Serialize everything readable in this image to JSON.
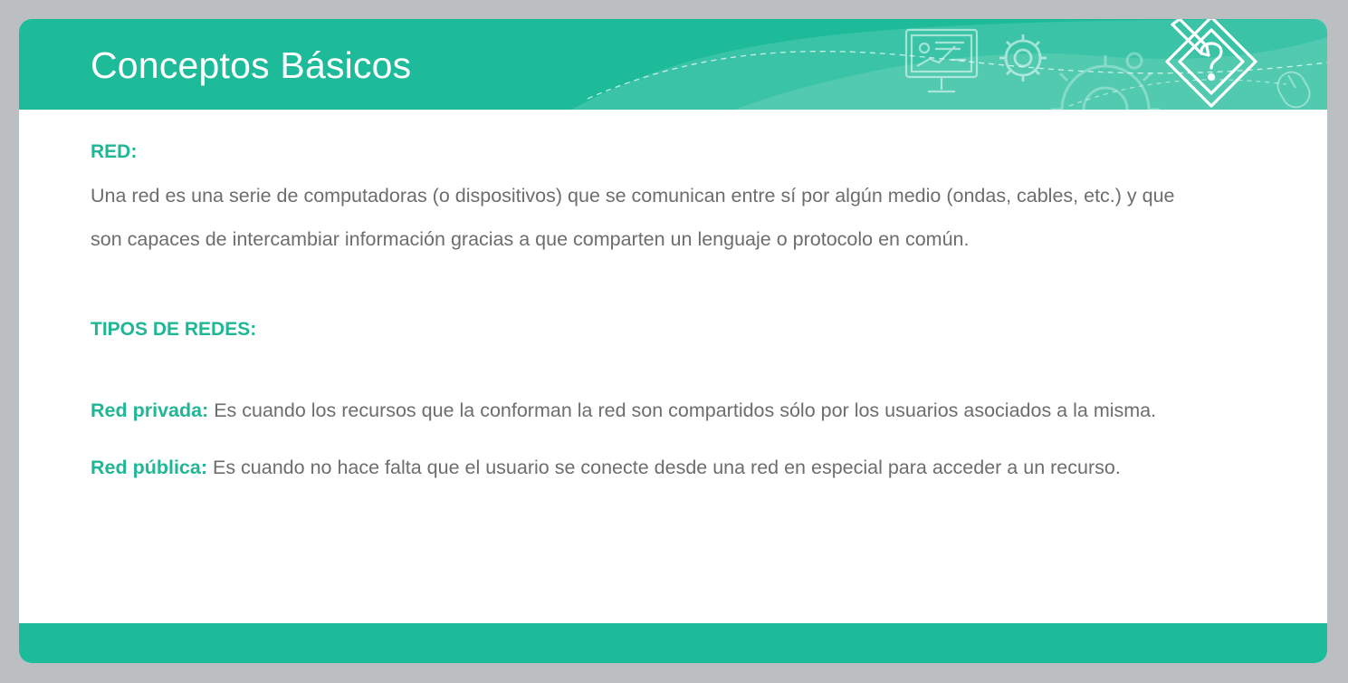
{
  "slide": {
    "title": "Conceptos Básicos",
    "colors": {
      "accent": "#1dbb99",
      "heading_text": "#1fb795",
      "body_text": "#6d6d6d",
      "frame_background": "#bcbfc2"
    },
    "header_icons": [
      "presentation-screen-icon",
      "gear-icon",
      "large-gear-icon",
      "pencil-puzzle-icon",
      "mouse-icon"
    ]
  },
  "content": {
    "red": {
      "heading": "RED:",
      "text": "Una red es una serie de computadoras (o dispositivos) que se comunican entre sí por algún medio (ondas, cables, etc.) y que son capaces de intercambiar información gracias a que comparten un lenguaje o protocolo en común."
    },
    "tipos": {
      "heading": "TIPOS DE REDES:",
      "items": [
        {
          "term": "Red privada:",
          "text": " Es cuando los recursos que la conforman la red son compartidos sólo por los usuarios asociados a la misma."
        },
        {
          "term": "Red pública:",
          "text": " Es cuando no hace falta que el usuario se conecte desde una red en especial para acceder a un recurso."
        }
      ]
    }
  }
}
